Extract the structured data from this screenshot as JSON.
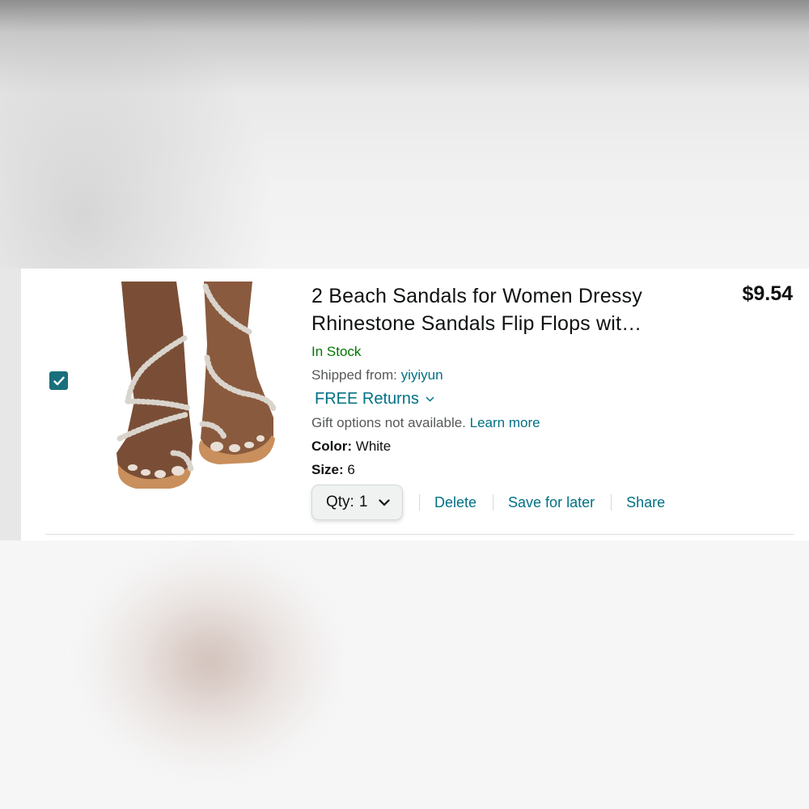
{
  "cart_item": {
    "selected": true,
    "title": "2 Beach Sandals for Women Dressy Rhinestone Sandals Flip Flops wit…",
    "price": "$9.54",
    "stock": "In Stock",
    "shipped_label": "Shipped from:",
    "seller": "yiyiyun",
    "returns": "FREE Returns",
    "gift_text": "Gift options not available.",
    "gift_link": "Learn more",
    "color_label": "Color:",
    "color_value": "White",
    "size_label": "Size:",
    "size_value": "6",
    "qty_label": "Qty:",
    "qty_value": "1",
    "actions": {
      "delete": "Delete",
      "save_for_later": "Save for later",
      "share": "Share"
    }
  },
  "icons": {
    "checkbox": "checkmark-icon",
    "returns": "chevron-down-icon",
    "qty": "chevron-down-icon"
  },
  "colors": {
    "link": "#007185",
    "in_stock": "#007600",
    "checkbox": "#1a6f7c"
  }
}
